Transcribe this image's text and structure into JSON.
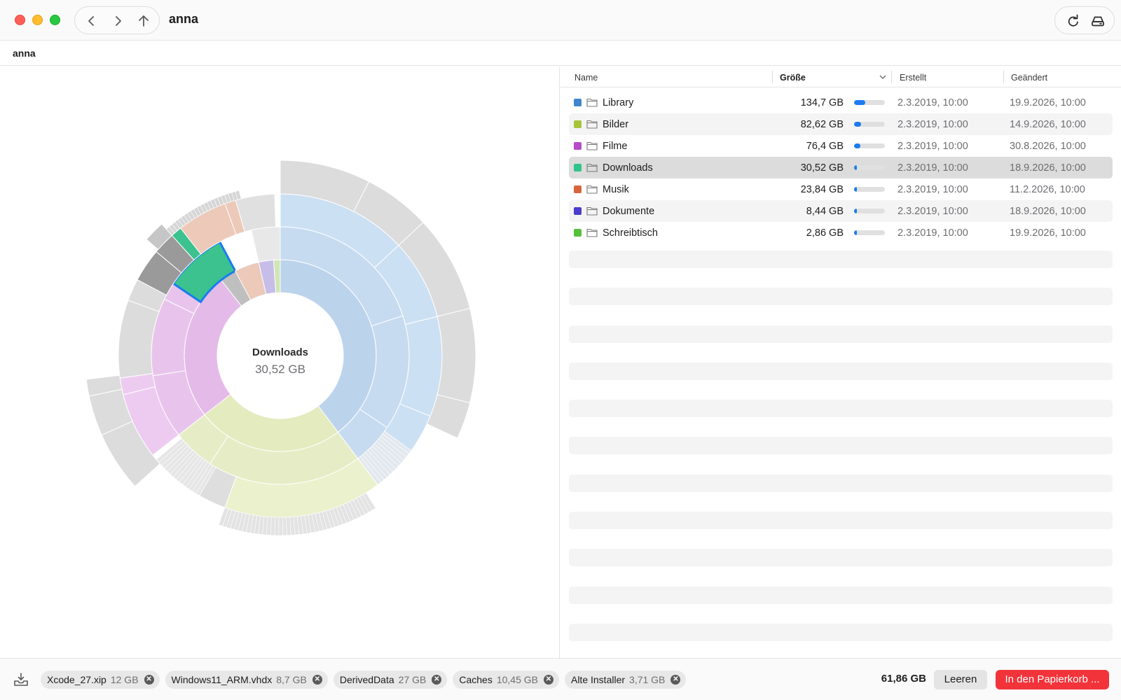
{
  "window": {
    "title": "anna"
  },
  "breadcrumb": {
    "path": "anna"
  },
  "toolbar": {
    "back_icon": "chevron-left-icon",
    "forward_icon": "chevron-right-icon",
    "up_icon": "arrow-up-icon",
    "refresh_icon": "refresh-icon",
    "disk_icon": "drive-icon"
  },
  "sunburst": {
    "center_name": "Downloads",
    "center_size": "30,52 GB",
    "highlight_color": "#1a7cf0"
  },
  "table": {
    "columns": [
      {
        "label": "Name"
      },
      {
        "label": "Größe"
      },
      {
        "label": "Erstellt"
      },
      {
        "label": "Geändert"
      }
    ],
    "sorted_by": "Größe",
    "rows": [
      {
        "color": "#3f86cc",
        "name": "Library",
        "size": "134,7 GB",
        "fraction": 0.34,
        "created": "2.3.2019, 10:00",
        "modified": "19.9.2026, 10:00"
      },
      {
        "color": "#a7c43a",
        "name": "Bilder",
        "size": "82,62 GB",
        "fraction": 0.21,
        "created": "2.3.2019, 10:00",
        "modified": "14.9.2026, 10:00"
      },
      {
        "color": "#b44bc9",
        "name": "Filme",
        "size": "76,4 GB",
        "fraction": 0.19,
        "created": "2.3.2019, 10:00",
        "modified": "30.8.2026, 10:00"
      },
      {
        "color": "#2ec48a",
        "name": "Downloads",
        "size": "30,52 GB",
        "fraction": 0.08,
        "created": "2.3.2019, 10:00",
        "modified": "18.9.2026, 10:00"
      },
      {
        "color": "#d6653e",
        "name": "Musik",
        "size": "23,84 GB",
        "fraction": 0.06,
        "created": "2.3.2019, 10:00",
        "modified": "11.2.2026, 10:00"
      },
      {
        "color": "#4a3dcc",
        "name": "Dokumente",
        "size": "8,44 GB",
        "fraction": 0.03,
        "created": "2.3.2019, 10:00",
        "modified": "18.9.2026, 10:00"
      },
      {
        "color": "#55c03a",
        "name": "Schreibtisch",
        "size": "2,86 GB",
        "fraction": 0.01,
        "created": "2.3.2019, 10:00",
        "modified": "19.9.2026, 10:00"
      }
    ],
    "selected_index": 3,
    "bar_color": "#1a7cf0"
  },
  "bottom": {
    "tray_icon": "tray-download-icon",
    "chips": [
      {
        "name": "Xcode_27.xip",
        "size": "12 GB"
      },
      {
        "name": "Windows11_ARM.vhdx",
        "size": "8,7 GB"
      },
      {
        "name": "DerivedData",
        "size": "27 GB"
      },
      {
        "name": "Caches",
        "size": "10,45 GB"
      },
      {
        "name": "Alte Installer",
        "size": "3,71 GB"
      }
    ],
    "total": "61,86 GB",
    "empty_label": "Leeren",
    "trash_label": "In den Papierkorb ...",
    "trash_color": "#f2333a"
  }
}
